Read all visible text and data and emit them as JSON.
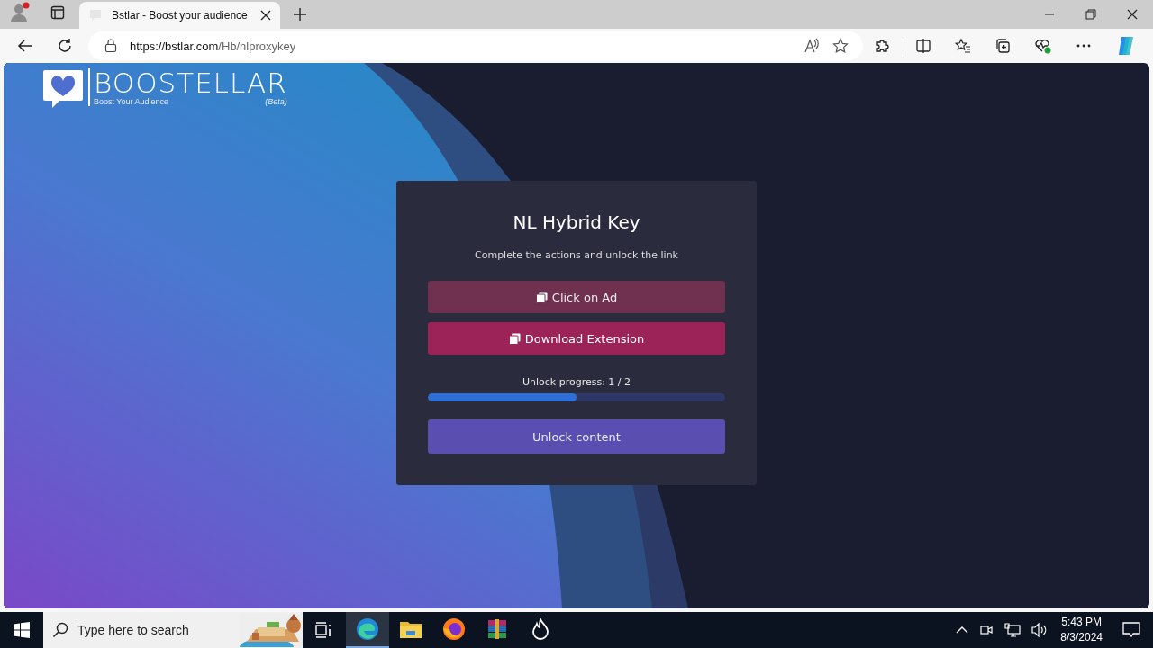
{
  "browser": {
    "tab": {
      "title": "Bstlar - Boost your audience"
    },
    "url": {
      "host": "https://bstlar.com",
      "path": "/Hb/nlproxykey"
    }
  },
  "page": {
    "logo": {
      "name": "BOOSTELLAR",
      "tagline": "Boost Your Audience",
      "badge": "(Beta)"
    },
    "card": {
      "title": "NL Hybrid Key",
      "subtitle": "Complete the actions and unlock the link",
      "actions": [
        {
          "label": "Click on Ad",
          "done": true
        },
        {
          "label": "Download Extension",
          "done": false
        }
      ],
      "progress": {
        "label": "Unlock progress: 1 / 2",
        "level": 0.5
      },
      "unlock_button": "Unlock content"
    }
  },
  "taskbar": {
    "search": {
      "placeholder": "Type here to search"
    },
    "apps": [
      {
        "kind": "edge",
        "selected": true
      },
      {
        "kind": "folder",
        "selected": false
      },
      {
        "kind": "firefox",
        "selected": false
      },
      {
        "kind": "archive",
        "selected": false
      },
      {
        "kind": "flame",
        "selected": false
      }
    ],
    "time": "5:43 PM",
    "date": "8/3/2024"
  }
}
